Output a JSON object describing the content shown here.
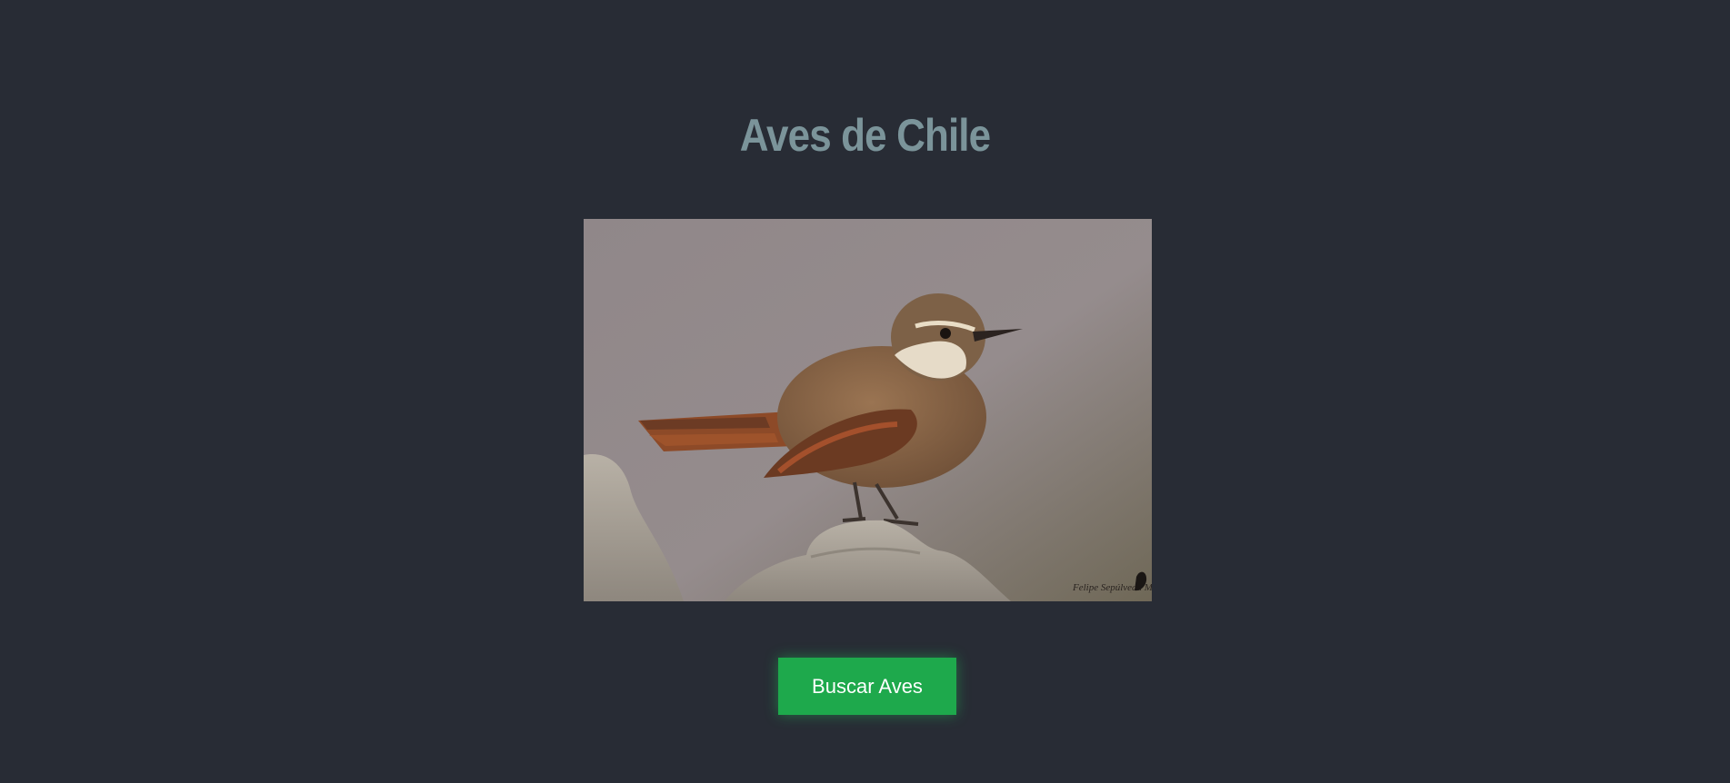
{
  "page": {
    "title": "Aves de Chile",
    "photo_alt": "Ave posada sobre una roca",
    "photo_credit": "Felipe Sepúlveda M.",
    "search_button_label": "Buscar Aves"
  },
  "colors": {
    "background": "#282c35",
    "title": "#7b949a",
    "button": "#1ea94c",
    "button_text": "#ffffff"
  }
}
